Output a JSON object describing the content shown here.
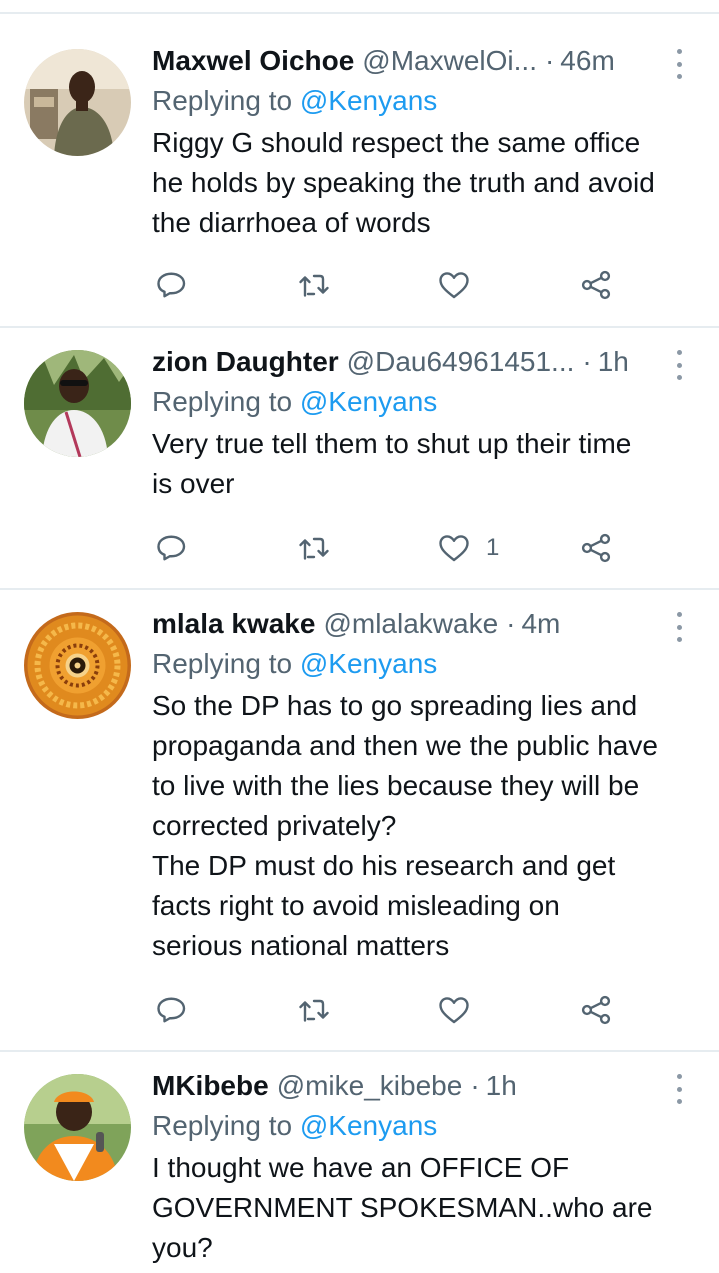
{
  "tweets": [
    {
      "name": "Maxwel Oichoe",
      "handle": "@MaxwelOi...",
      "time": "46m",
      "replying_prefix": "Replying to",
      "replying_to": "@Kenyans",
      "text": "Riggy G should respect the same office\nhe holds by speaking the truth and avoid\nthe diarrhoea of words",
      "likes": ""
    },
    {
      "name": "zion Daughter",
      "handle": "@Dau64961451...",
      "time": "1h",
      "replying_prefix": "Replying to",
      "replying_to": "@Kenyans",
      "text": "Very true tell them to shut up their time\nis over",
      "likes": "1"
    },
    {
      "name": "mlala kwake",
      "handle": "@mlalakwake",
      "time": "4m",
      "replying_prefix": "Replying to",
      "replying_to": "@Kenyans",
      "text": "So the DP has to go spreading lies and\npropaganda and then we the public have\nto live with the lies because they will be\ncorrected privately?\nThe DP must do his research and get\nfacts right to avoid misleading on\nserious national matters",
      "likes": ""
    },
    {
      "name": "MKibebe",
      "handle": "@mike_kibebe",
      "time": "1h",
      "replying_prefix": "Replying to",
      "replying_to": "@Kenyans",
      "text": "I thought we have an OFFICE OF\nGOVERNMENT SPOKESMAN..who are\nyou?",
      "likes": ""
    }
  ],
  "separator": "·",
  "icons": {
    "reply": "reply-icon",
    "retweet": "retweet-icon",
    "like": "heart-icon",
    "share": "share-icon",
    "more": "more-vertical-icon"
  },
  "colors": {
    "accent": "#1d9bf0",
    "secondary_text": "#536471",
    "icon": "#536471",
    "divider": "#e6ecf0"
  }
}
